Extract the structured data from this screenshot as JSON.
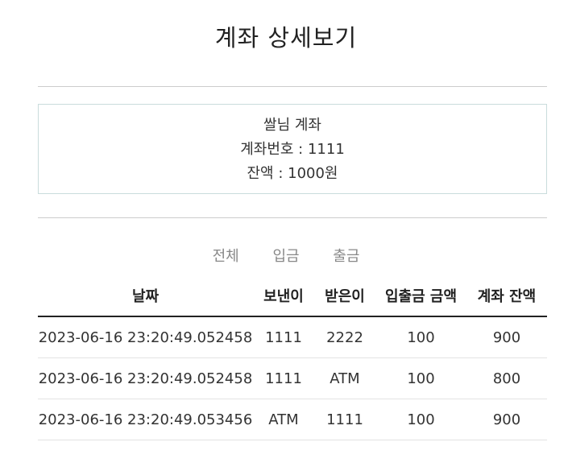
{
  "page": {
    "title": "계좌 상세보기"
  },
  "account": {
    "name_line": "쌀님 계좌",
    "number_line": "계좌번호 : 1111",
    "balance_line": "잔액 : 1000원"
  },
  "filters": {
    "items": [
      {
        "label": "전체"
      },
      {
        "label": "입금"
      },
      {
        "label": "출금"
      }
    ]
  },
  "table": {
    "headers": {
      "date": "날짜",
      "sender": "보낸이",
      "receiver": "받은이",
      "amount": "입출금 금액",
      "balance": "계좌 잔액"
    },
    "rows": [
      {
        "date": "2023-06-16 23:20:49.052458",
        "sender": "1111",
        "receiver": "2222",
        "amount": "100",
        "balance": "900"
      },
      {
        "date": "2023-06-16 23:20:49.052458",
        "sender": "1111",
        "receiver": "ATM",
        "amount": "100",
        "balance": "800"
      },
      {
        "date": "2023-06-16 23:20:49.053456",
        "sender": "ATM",
        "receiver": "1111",
        "amount": "100",
        "balance": "900"
      }
    ]
  }
}
